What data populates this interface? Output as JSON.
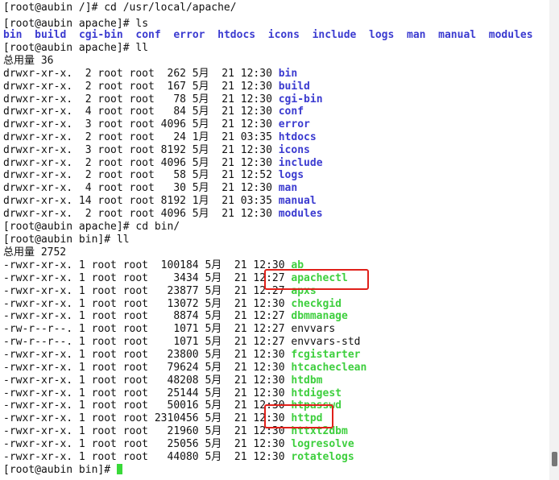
{
  "top_cmd": "[root@aubin /]# cd /usr/local/apache/",
  "prompt_apache": "[root@aubin apache]# ",
  "ls_cmd": "ls",
  "ls_items": [
    "bin",
    "build",
    "cgi-bin",
    "conf",
    "error",
    "htdocs",
    "icons",
    "include",
    "logs",
    "man",
    "manual",
    "modules"
  ],
  "ll_cmd": "ll",
  "total1": "总用量 36",
  "dir_list": [
    {
      "pre": "drwxr-xr-x.  2 root root  262 5月  21 12:30 ",
      "name": "bin"
    },
    {
      "pre": "drwxr-xr-x.  2 root root  167 5月  21 12:30 ",
      "name": "build"
    },
    {
      "pre": "drwxr-xr-x.  2 root root   78 5月  21 12:30 ",
      "name": "cgi-bin"
    },
    {
      "pre": "drwxr-xr-x.  4 root root   84 5月  21 12:30 ",
      "name": "conf"
    },
    {
      "pre": "drwxr-xr-x.  3 root root 4096 5月  21 12:30 ",
      "name": "error"
    },
    {
      "pre": "drwxr-xr-x.  2 root root   24 1月  21 03:35 ",
      "name": "htdocs"
    },
    {
      "pre": "drwxr-xr-x.  3 root root 8192 5月  21 12:30 ",
      "name": "icons"
    },
    {
      "pre": "drwxr-xr-x.  2 root root 4096 5月  21 12:30 ",
      "name": "include"
    },
    {
      "pre": "drwxr-xr-x.  2 root root   58 5月  21 12:52 ",
      "name": "logs"
    },
    {
      "pre": "drwxr-xr-x.  4 root root   30 5月  21 12:30 ",
      "name": "man"
    },
    {
      "pre": "drwxr-xr-x. 14 root root 8192 1月  21 03:35 ",
      "name": "manual"
    },
    {
      "pre": "drwxr-xr-x.  2 root root 4096 5月  21 12:30 ",
      "name": "modules"
    }
  ],
  "cd_cmd": "cd bin/",
  "prompt_bin": "[root@aubin bin]# ",
  "total2": "总用量 2752",
  "bin_list": [
    {
      "pre": "-rwxr-xr-x. 1 root root  100184 5月  21 12:30 ",
      "name": "ab",
      "kind": "exe"
    },
    {
      "pre": "-rwxr-xr-x. 1 root root    3434 5月  21 12:27 ",
      "name": "apachectl",
      "kind": "exe"
    },
    {
      "pre": "-rwxr-xr-x. 1 root root   23877 5月  21 12:27 ",
      "name": "apxs",
      "kind": "exe"
    },
    {
      "pre": "-rwxr-xr-x. 1 root root   13072 5月  21 12:30 ",
      "name": "checkgid",
      "kind": "exe"
    },
    {
      "pre": "-rwxr-xr-x. 1 root root    8874 5月  21 12:27 ",
      "name": "dbmmanage",
      "kind": "exe"
    },
    {
      "pre": "-rw-r--r--. 1 root root    1071 5月  21 12:27 ",
      "name": "envvars",
      "kind": "plain"
    },
    {
      "pre": "-rw-r--r--. 1 root root    1071 5月  21 12:27 ",
      "name": "envvars-std",
      "kind": "plain"
    },
    {
      "pre": "-rwxr-xr-x. 1 root root   23800 5月  21 12:30 ",
      "name": "fcgistarter",
      "kind": "exe"
    },
    {
      "pre": "-rwxr-xr-x. 1 root root   79624 5月  21 12:30 ",
      "name": "htcacheclean",
      "kind": "exe"
    },
    {
      "pre": "-rwxr-xr-x. 1 root root   48208 5月  21 12:30 ",
      "name": "htdbm",
      "kind": "exe"
    },
    {
      "pre": "-rwxr-xr-x. 1 root root   25144 5月  21 12:30 ",
      "name": "htdigest",
      "kind": "exe"
    },
    {
      "pre": "-rwxr-xr-x. 1 root root   50016 5月  21 12:30 ",
      "name": "htpasswd",
      "kind": "exe"
    },
    {
      "pre": "-rwxr-xr-x. 1 root root 2310456 5月  21 12:30 ",
      "name": "httpd",
      "kind": "exe"
    },
    {
      "pre": "-rwxr-xr-x. 1 root root   21960 5月  21 12:30 ",
      "name": "httxt2dbm",
      "kind": "exe"
    },
    {
      "pre": "-rwxr-xr-x. 1 root root   25056 5月  21 12:30 ",
      "name": "logresolve",
      "kind": "exe"
    },
    {
      "pre": "-rwxr-xr-x. 1 root root   44080 5月  21 12:30 ",
      "name": "rotatelogs",
      "kind": "exe"
    }
  ],
  "colors": {
    "dir": "#3b3bd0",
    "exe": "#3ecf3e",
    "highlight": "#e0201a"
  }
}
